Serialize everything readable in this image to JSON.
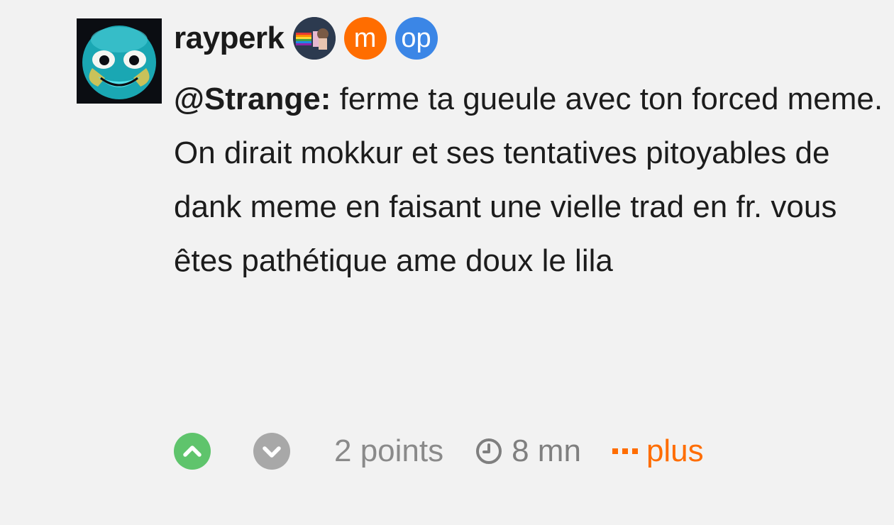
{
  "comment": {
    "author": "rayperk",
    "badges": {
      "mod_label": "m",
      "op_label": "op"
    },
    "mention": "@Strange:",
    "text_first_line_rest": " ferme ta gueule avec ton forced meme.",
    "text_paragraph_2": "On dirait mokkur et ses tentatives pitoyables de dank meme en faisant une vielle trad en fr. vous êtes pathétique ame doux le lila"
  },
  "actions": {
    "points": "2 points",
    "time": "8 mn",
    "more_label": "plus",
    "upvote_active": true,
    "downvote_active": false
  },
  "icons": {
    "upvote": "chevron-up-icon",
    "downvote": "chevron-down-icon",
    "time": "clock-icon",
    "more": "dots-icon"
  },
  "colors": {
    "background": "#f2f2f2",
    "upvote": "#5fc46c",
    "downvote": "#a8a8a8",
    "mod_badge": "#ff6d00",
    "op_badge": "#3b86e6",
    "more": "#ff6d00"
  }
}
